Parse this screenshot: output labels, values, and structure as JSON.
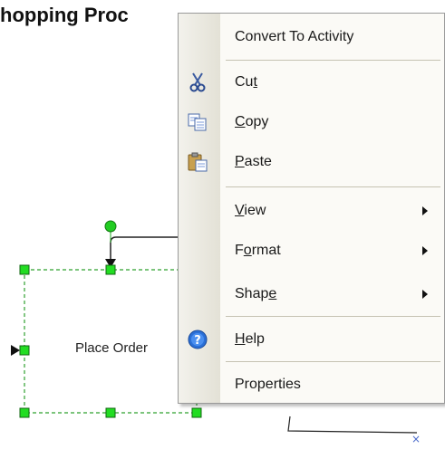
{
  "diagram": {
    "title": "hopping Proc",
    "shape_label": "Place Order"
  },
  "context_menu": {
    "items": [
      {
        "id": "convert",
        "before": "Convert To Activity",
        "mn": "",
        "after": "",
        "icon": "",
        "submenu": false
      },
      {
        "id": "cut",
        "before": "Cu",
        "mn": "t",
        "after": "",
        "icon": "scissors-icon",
        "submenu": false
      },
      {
        "id": "copy",
        "before": "",
        "mn": "C",
        "after": "opy",
        "icon": "copy-icon",
        "submenu": false
      },
      {
        "id": "paste",
        "before": "",
        "mn": "P",
        "after": "aste",
        "icon": "paste-icon",
        "submenu": false
      },
      {
        "id": "view",
        "before": "",
        "mn": "V",
        "after": "iew",
        "icon": "",
        "submenu": true
      },
      {
        "id": "format",
        "before": "F",
        "mn": "o",
        "after": "rmat",
        "icon": "",
        "submenu": true
      },
      {
        "id": "shape",
        "before": "Shap",
        "mn": "e",
        "after": "",
        "icon": "",
        "submenu": true
      },
      {
        "id": "help",
        "before": "",
        "mn": "H",
        "after": "elp",
        "icon": "help-icon",
        "submenu": false
      },
      {
        "id": "properties",
        "before": "Properties",
        "mn": "",
        "after": "",
        "icon": "",
        "submenu": false
      }
    ]
  },
  "colors": {
    "menu_bg": "#fbfaf6",
    "handle_green": "#22cc22",
    "help_blue": "#2a6fd6"
  }
}
